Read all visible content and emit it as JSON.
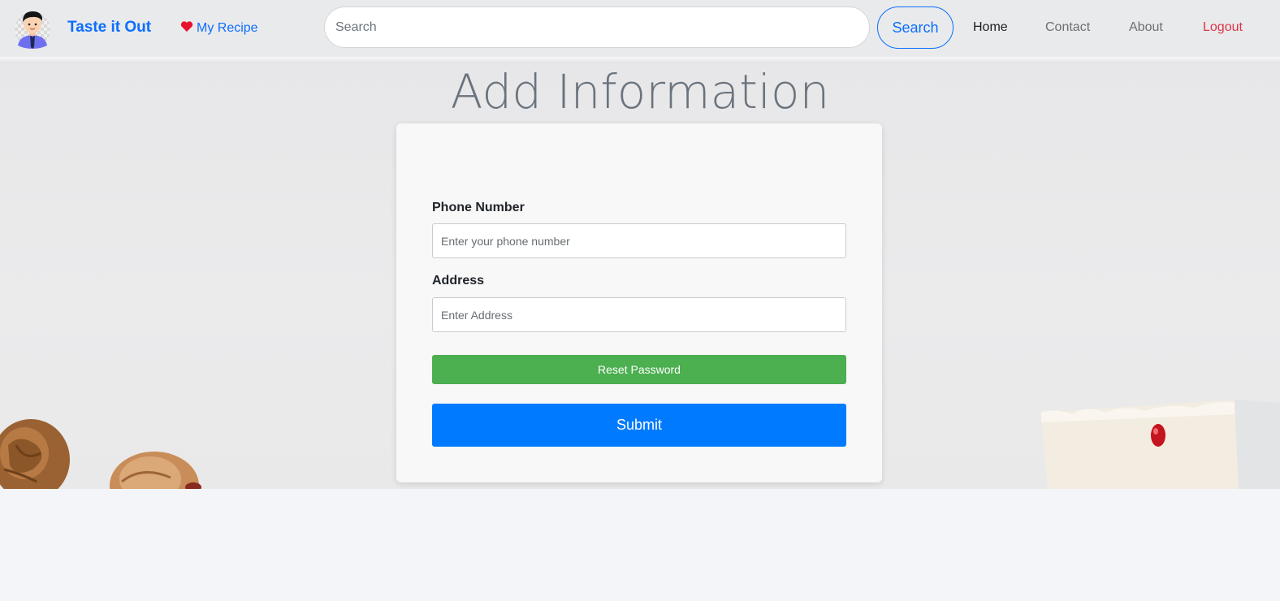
{
  "navbar": {
    "brand": "Taste it Out",
    "my_recipe_label": "My Recipe",
    "search_placeholder": "Search",
    "search_button_label": "Search",
    "links": {
      "home": "Home",
      "contact": "Contact",
      "about": "About",
      "logout": "Logout"
    }
  },
  "page": {
    "title": "Add Information"
  },
  "form": {
    "phone_label": "Phone Number",
    "phone_placeholder": "Enter your phone number",
    "address_label": "Address",
    "address_placeholder": "Enter Address",
    "reset_button_label": "Reset Password",
    "submit_button_label": "Submit"
  },
  "colors": {
    "brand_blue": "#0d6efd",
    "logout_red": "#dc3545",
    "reset_green": "#4caf50",
    "submit_blue": "#007bff"
  },
  "icons": {
    "avatar": "user-avatar",
    "heart": "heart-icon"
  }
}
